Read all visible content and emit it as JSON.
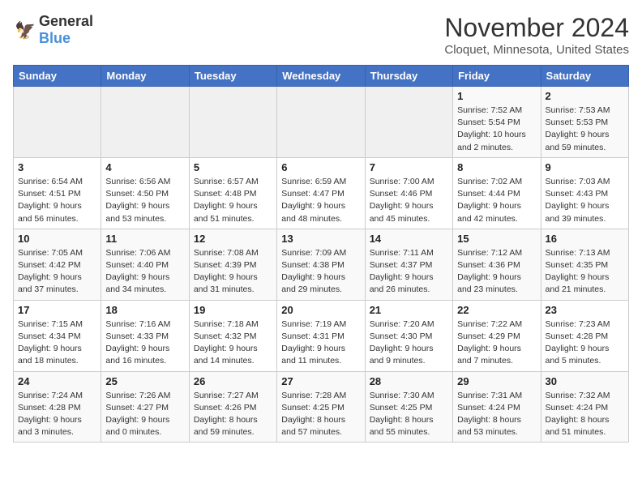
{
  "header": {
    "logo_general": "General",
    "logo_blue": "Blue",
    "month": "November 2024",
    "location": "Cloquet, Minnesota, United States"
  },
  "weekdays": [
    "Sunday",
    "Monday",
    "Tuesday",
    "Wednesday",
    "Thursday",
    "Friday",
    "Saturday"
  ],
  "weeks": [
    [
      {
        "day": "",
        "info": ""
      },
      {
        "day": "",
        "info": ""
      },
      {
        "day": "",
        "info": ""
      },
      {
        "day": "",
        "info": ""
      },
      {
        "day": "",
        "info": ""
      },
      {
        "day": "1",
        "info": "Sunrise: 7:52 AM\nSunset: 5:54 PM\nDaylight: 10 hours\nand 2 minutes."
      },
      {
        "day": "2",
        "info": "Sunrise: 7:53 AM\nSunset: 5:53 PM\nDaylight: 9 hours\nand 59 minutes."
      }
    ],
    [
      {
        "day": "3",
        "info": "Sunrise: 6:54 AM\nSunset: 4:51 PM\nDaylight: 9 hours\nand 56 minutes."
      },
      {
        "day": "4",
        "info": "Sunrise: 6:56 AM\nSunset: 4:50 PM\nDaylight: 9 hours\nand 53 minutes."
      },
      {
        "day": "5",
        "info": "Sunrise: 6:57 AM\nSunset: 4:48 PM\nDaylight: 9 hours\nand 51 minutes."
      },
      {
        "day": "6",
        "info": "Sunrise: 6:59 AM\nSunset: 4:47 PM\nDaylight: 9 hours\nand 48 minutes."
      },
      {
        "day": "7",
        "info": "Sunrise: 7:00 AM\nSunset: 4:46 PM\nDaylight: 9 hours\nand 45 minutes."
      },
      {
        "day": "8",
        "info": "Sunrise: 7:02 AM\nSunset: 4:44 PM\nDaylight: 9 hours\nand 42 minutes."
      },
      {
        "day": "9",
        "info": "Sunrise: 7:03 AM\nSunset: 4:43 PM\nDaylight: 9 hours\nand 39 minutes."
      }
    ],
    [
      {
        "day": "10",
        "info": "Sunrise: 7:05 AM\nSunset: 4:42 PM\nDaylight: 9 hours\nand 37 minutes."
      },
      {
        "day": "11",
        "info": "Sunrise: 7:06 AM\nSunset: 4:40 PM\nDaylight: 9 hours\nand 34 minutes."
      },
      {
        "day": "12",
        "info": "Sunrise: 7:08 AM\nSunset: 4:39 PM\nDaylight: 9 hours\nand 31 minutes."
      },
      {
        "day": "13",
        "info": "Sunrise: 7:09 AM\nSunset: 4:38 PM\nDaylight: 9 hours\nand 29 minutes."
      },
      {
        "day": "14",
        "info": "Sunrise: 7:11 AM\nSunset: 4:37 PM\nDaylight: 9 hours\nand 26 minutes."
      },
      {
        "day": "15",
        "info": "Sunrise: 7:12 AM\nSunset: 4:36 PM\nDaylight: 9 hours\nand 23 minutes."
      },
      {
        "day": "16",
        "info": "Sunrise: 7:13 AM\nSunset: 4:35 PM\nDaylight: 9 hours\nand 21 minutes."
      }
    ],
    [
      {
        "day": "17",
        "info": "Sunrise: 7:15 AM\nSunset: 4:34 PM\nDaylight: 9 hours\nand 18 minutes."
      },
      {
        "day": "18",
        "info": "Sunrise: 7:16 AM\nSunset: 4:33 PM\nDaylight: 9 hours\nand 16 minutes."
      },
      {
        "day": "19",
        "info": "Sunrise: 7:18 AM\nSunset: 4:32 PM\nDaylight: 9 hours\nand 14 minutes."
      },
      {
        "day": "20",
        "info": "Sunrise: 7:19 AM\nSunset: 4:31 PM\nDaylight: 9 hours\nand 11 minutes."
      },
      {
        "day": "21",
        "info": "Sunrise: 7:20 AM\nSunset: 4:30 PM\nDaylight: 9 hours\nand 9 minutes."
      },
      {
        "day": "22",
        "info": "Sunrise: 7:22 AM\nSunset: 4:29 PM\nDaylight: 9 hours\nand 7 minutes."
      },
      {
        "day": "23",
        "info": "Sunrise: 7:23 AM\nSunset: 4:28 PM\nDaylight: 9 hours\nand 5 minutes."
      }
    ],
    [
      {
        "day": "24",
        "info": "Sunrise: 7:24 AM\nSunset: 4:28 PM\nDaylight: 9 hours\nand 3 minutes."
      },
      {
        "day": "25",
        "info": "Sunrise: 7:26 AM\nSunset: 4:27 PM\nDaylight: 9 hours\nand 0 minutes."
      },
      {
        "day": "26",
        "info": "Sunrise: 7:27 AM\nSunset: 4:26 PM\nDaylight: 8 hours\nand 59 minutes."
      },
      {
        "day": "27",
        "info": "Sunrise: 7:28 AM\nSunset: 4:25 PM\nDaylight: 8 hours\nand 57 minutes."
      },
      {
        "day": "28",
        "info": "Sunrise: 7:30 AM\nSunset: 4:25 PM\nDaylight: 8 hours\nand 55 minutes."
      },
      {
        "day": "29",
        "info": "Sunrise: 7:31 AM\nSunset: 4:24 PM\nDaylight: 8 hours\nand 53 minutes."
      },
      {
        "day": "30",
        "info": "Sunrise: 7:32 AM\nSunset: 4:24 PM\nDaylight: 8 hours\nand 51 minutes."
      }
    ]
  ]
}
